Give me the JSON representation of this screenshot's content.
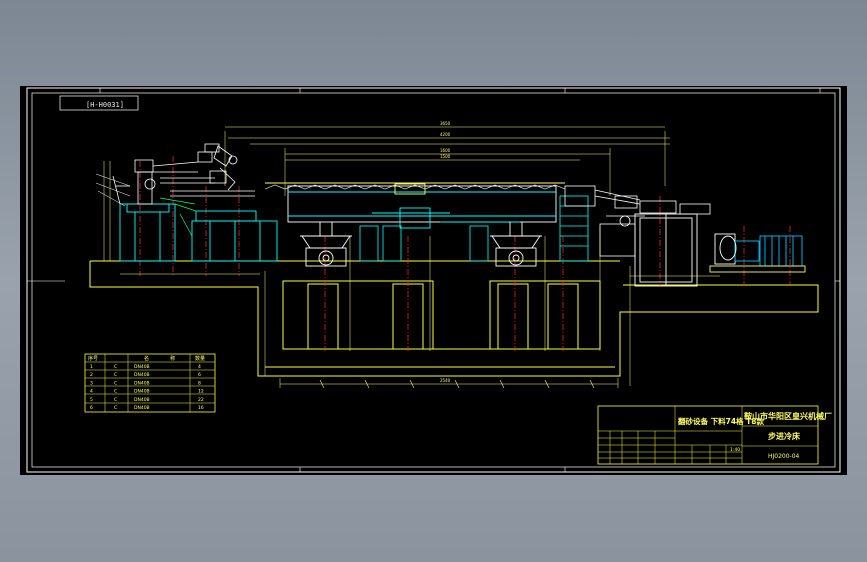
{
  "drawing": {
    "tag_label": "[H-H0031]",
    "colors": {
      "background": "#000000",
      "frame": "#ffffff",
      "foundation": "#ffff00",
      "steel": "#00ffff",
      "centerline": "#ff3030",
      "dimension": "#ffff00",
      "equipment": "#ffffff",
      "motor": "#00c0ff"
    },
    "dimensions": [
      "3650",
      "4200",
      "1600",
      "1500",
      "2540"
    ],
    "parts_table": {
      "headers": [
        "序号",
        "名",
        "称",
        "数量"
      ],
      "rows": [
        [
          "1",
          "C",
          "DN40B",
          "4"
        ],
        [
          "2",
          "C",
          "DN40B",
          "6"
        ],
        [
          "3",
          "C",
          "DN40B",
          "8"
        ],
        [
          "4",
          "C",
          "DN40B",
          "12"
        ],
        [
          "5",
          "C",
          "DN40B",
          "22"
        ],
        [
          "6",
          "C",
          "DN40B",
          "16"
        ]
      ]
    },
    "title_block": {
      "desc": "翻砂设备 下料74格 T8款",
      "company": "鞍山市华阳区皇兴机械厂",
      "name": "步进冷床",
      "code": "HJ0200-04",
      "scale": "1:40"
    }
  }
}
